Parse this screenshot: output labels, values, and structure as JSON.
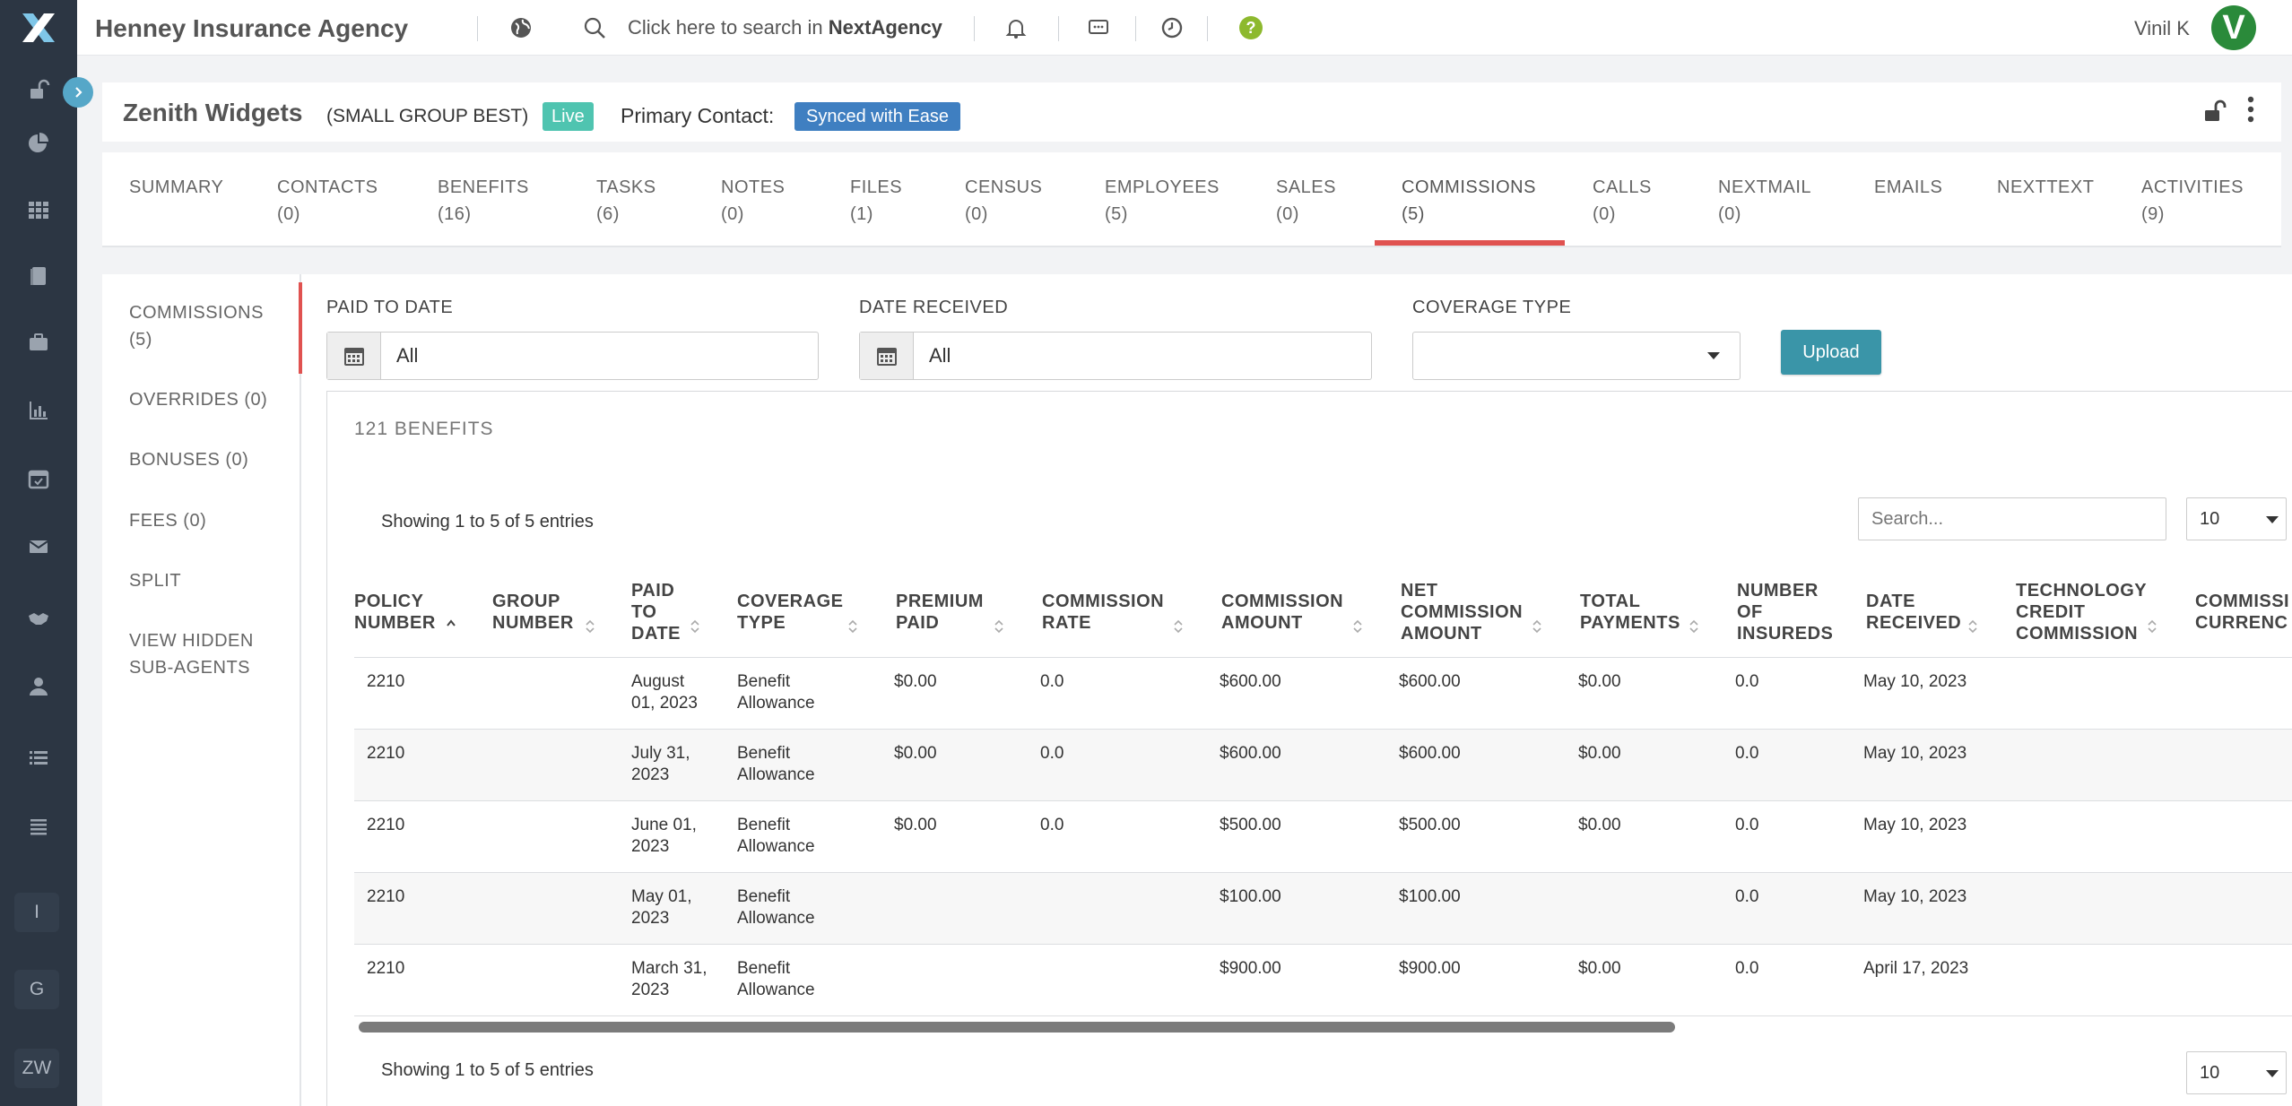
{
  "topbar": {
    "agency_name": "Henney Insurance Agency",
    "search_prefix": "Click here to search in ",
    "search_brand": "NextAgency",
    "user_name": "Vinil K",
    "avatar_letter": "V"
  },
  "rail": {
    "letters": [
      "I",
      "G",
      "ZW"
    ]
  },
  "header": {
    "company": "Zenith Widgets",
    "plan": "(SMALL GROUP BEST)",
    "status": "Live",
    "primary_contact_label": "Primary Contact:",
    "primary_contact_value": "Synced with Ease"
  },
  "tabs": [
    {
      "label": "SUMMARY",
      "count": ""
    },
    {
      "label": "CONTACTS",
      "count": "(0)"
    },
    {
      "label": "BENEFITS",
      "count": "(16)"
    },
    {
      "label": "TASKS",
      "count": "(6)"
    },
    {
      "label": "NOTES",
      "count": "(0)"
    },
    {
      "label": "FILES",
      "count": "(1)"
    },
    {
      "label": "CENSUS",
      "count": "(0)"
    },
    {
      "label": "EMPLOYEES",
      "count": "(5)"
    },
    {
      "label": "SALES",
      "count": "(0)"
    },
    {
      "label": "COMMISSIONS",
      "count": "(5)"
    },
    {
      "label": "CALLS",
      "count": "(0)"
    },
    {
      "label": "NEXTMAIL",
      "count": "(0)"
    },
    {
      "label": "EMAILS",
      "count": ""
    },
    {
      "label": "NEXTTEXT",
      "count": ""
    },
    {
      "label": "ACTIVITIES",
      "count": "(9)"
    }
  ],
  "subnav": [
    {
      "line1": "COMMISSIONS",
      "line2": "(5)"
    },
    {
      "line1": "OVERRIDES (0)",
      "line2": ""
    },
    {
      "line1": "BONUSES (0)",
      "line2": ""
    },
    {
      "line1": "FEES (0)",
      "line2": ""
    },
    {
      "line1": "SPLIT",
      "line2": ""
    },
    {
      "line1": "VIEW HIDDEN",
      "line2": "SUB-AGENTS"
    }
  ],
  "filters": {
    "paid_to_date_label": "PAID TO DATE",
    "paid_to_date_value": "All",
    "date_received_label": "DATE RECEIVED",
    "date_received_value": "All",
    "coverage_type_label": "COVERAGE TYPE",
    "coverage_type_value": "",
    "upload_label": "Upload"
  },
  "table": {
    "count_title": "121 BENEFITS",
    "showing_top": "Showing 1 to 5 of 5 entries",
    "showing_bottom": "Showing 1 to 5 of 5 entries",
    "search_placeholder": "Search...",
    "page_length": "10",
    "columns": [
      [
        "POLICY",
        "NUMBER"
      ],
      [
        "GROUP",
        "NUMBER"
      ],
      [
        "PAID",
        "TO",
        "DATE"
      ],
      [
        "COVERAGE",
        "TYPE"
      ],
      [
        "PREMIUM",
        "PAID"
      ],
      [
        "COMMISSION",
        "RATE"
      ],
      [
        "COMMISSION",
        "AMOUNT"
      ],
      [
        "NET",
        "COMMISSION",
        "AMOUNT"
      ],
      [
        "TOTAL",
        "PAYMENTS"
      ],
      [
        "NUMBER",
        "OF",
        "INSUREDS"
      ],
      [
        "DATE",
        "RECEIVED"
      ],
      [
        "TECHNOLOGY",
        "CREDIT",
        "COMMISSION"
      ],
      [
        "COMMISSI",
        "CURRENC"
      ]
    ],
    "rows": [
      {
        "policy": "2210",
        "group": "",
        "paid_to_1": "August",
        "paid_to_2": "01, 2023",
        "coverage_1": "Benefit",
        "coverage_2": "Allowance",
        "premium": "$0.00",
        "rate": "0.0",
        "amount": "$600.00",
        "net": "$600.00",
        "payments": "$0.00",
        "insureds": "0.0",
        "received": "May 10, 2023"
      },
      {
        "policy": "2210",
        "group": "",
        "paid_to_1": "July 31,",
        "paid_to_2": "2023",
        "coverage_1": "Benefit",
        "coverage_2": "Allowance",
        "premium": "$0.00",
        "rate": "0.0",
        "amount": "$600.00",
        "net": "$600.00",
        "payments": "$0.00",
        "insureds": "0.0",
        "received": "May 10, 2023"
      },
      {
        "policy": "2210",
        "group": "",
        "paid_to_1": "June 01,",
        "paid_to_2": "2023",
        "coverage_1": "Benefit",
        "coverage_2": "Allowance",
        "premium": "$0.00",
        "rate": "0.0",
        "amount": "$500.00",
        "net": "$500.00",
        "payments": "$0.00",
        "insureds": "0.0",
        "received": "May 10, 2023"
      },
      {
        "policy": "2210",
        "group": "",
        "paid_to_1": "May 01,",
        "paid_to_2": "2023",
        "coverage_1": "Benefit",
        "coverage_2": "Allowance",
        "premium": "",
        "rate": "",
        "amount": "$100.00",
        "net": "$100.00",
        "payments": "",
        "insureds": "0.0",
        "received": "May 10, 2023"
      },
      {
        "policy": "2210",
        "group": "",
        "paid_to_1": "March 31,",
        "paid_to_2": "2023",
        "coverage_1": "Benefit",
        "coverage_2": "Allowance",
        "premium": "",
        "rate": "",
        "amount": "$900.00",
        "net": "$900.00",
        "payments": "$0.00",
        "insureds": "0.0",
        "received": "April 17, 2023"
      }
    ]
  },
  "colors": {
    "rail": "#2c3643",
    "accent_red": "#e05250",
    "live_badge": "#4fc4b0",
    "contact_badge": "#3f7fc1",
    "upload_button": "#3a95a8",
    "avatar": "#2a8a3a"
  }
}
